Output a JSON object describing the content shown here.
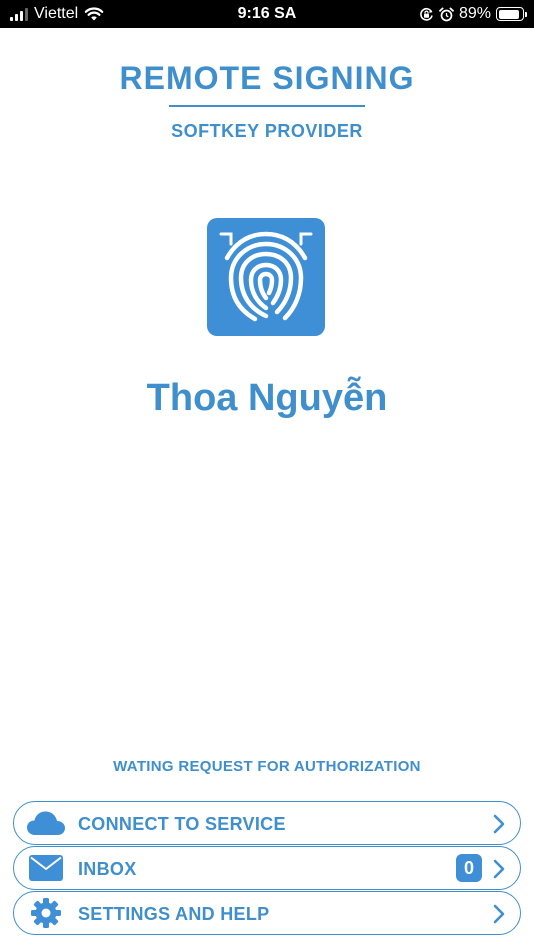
{
  "status_bar": {
    "carrier": "Viettel",
    "time": "9:16 SA",
    "battery_percent": "89%",
    "battery_level": 0.89,
    "icons": [
      "signal-icon",
      "wifi-icon",
      "orientation-lock-icon",
      "alarm-icon",
      "battery-icon"
    ]
  },
  "header": {
    "title": "REMOTE SIGNING",
    "subtitle": "SOFTKEY PROVIDER"
  },
  "logo": {
    "icon": "fingerprint-icon",
    "color": "#3f8fd6"
  },
  "user": {
    "name": "Thoa Nguyễn"
  },
  "status_message": "WATING REQUEST FOR AUTHORIZATION",
  "menu": {
    "connect": {
      "label": "CONNECT TO SERVICE",
      "icon": "cloud-icon"
    },
    "inbox": {
      "label": "INBOX",
      "icon": "mail-icon",
      "badge": "0"
    },
    "settings": {
      "label": "SETTINGS AND HELP",
      "icon": "gear-icon"
    }
  },
  "colors": {
    "accent": "#3f8fcd",
    "background": "#ffffff",
    "status_bar": "#000000"
  }
}
